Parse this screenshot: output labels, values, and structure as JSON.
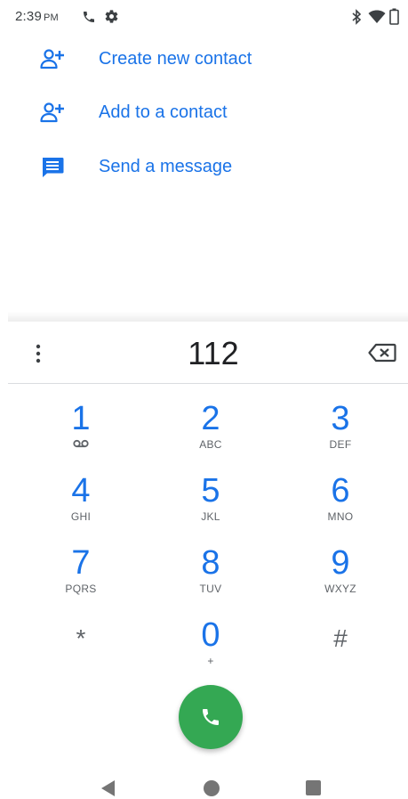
{
  "status_bar": {
    "time": "2:39",
    "ampm": "PM",
    "icons": [
      "phone-icon",
      "gear-icon",
      "bluetooth-icon",
      "wifi-icon",
      "battery-icon"
    ]
  },
  "actions": [
    {
      "label": "Create new contact",
      "icon": "add-person-icon"
    },
    {
      "label": "Add to a contact",
      "icon": "add-person-icon"
    },
    {
      "label": "Send a message",
      "icon": "message-icon"
    }
  ],
  "dialpad": {
    "entered_number": "112",
    "keys": [
      {
        "digit": "1",
        "letters": ""
      },
      {
        "digit": "2",
        "letters": "ABC"
      },
      {
        "digit": "3",
        "letters": "DEF"
      },
      {
        "digit": "4",
        "letters": "GHI"
      },
      {
        "digit": "5",
        "letters": "JKL"
      },
      {
        "digit": "6",
        "letters": "MNO"
      },
      {
        "digit": "7",
        "letters": "PQRS"
      },
      {
        "digit": "8",
        "letters": "TUV"
      },
      {
        "digit": "9",
        "letters": "WXYZ"
      },
      {
        "digit": "*",
        "letters": ""
      },
      {
        "digit": "0",
        "letters": "+"
      },
      {
        "digit": "#",
        "letters": ""
      }
    ]
  },
  "colors": {
    "accent": "#1a73e8",
    "call_button": "#34a853",
    "nav_icons": "#757575"
  }
}
